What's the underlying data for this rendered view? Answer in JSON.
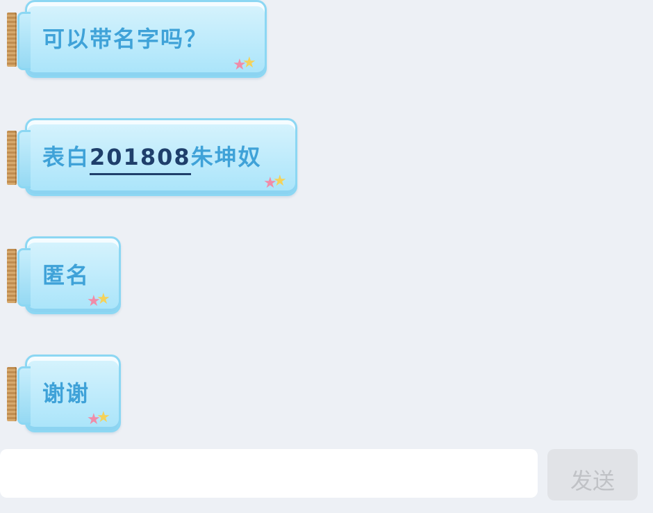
{
  "messages": [
    {
      "text": "可以带名字吗？"
    },
    {
      "text_before": "表白",
      "number": "201808",
      "text_after": "朱坤奴"
    },
    {
      "text": "匿名"
    },
    {
      "text": "谢谢"
    }
  ],
  "input": {
    "value": "",
    "placeholder": ""
  },
  "send_button": {
    "label": "发送"
  },
  "colors": {
    "background": "#edf0f5",
    "bubble_fill": "#a9e4fa",
    "bubble_border": "#8cd7f3",
    "bubble_text": "#3fa2d8",
    "highlight_text": "#1f3f6b",
    "cork": "#c08d50",
    "star_pink": "#f08ca8",
    "star_yellow": "#f4d25a",
    "send_button_bg": "#e1e3e7",
    "send_button_text": "#c0c2c6"
  },
  "icons": {
    "bubble_decoration": "star-icon"
  }
}
